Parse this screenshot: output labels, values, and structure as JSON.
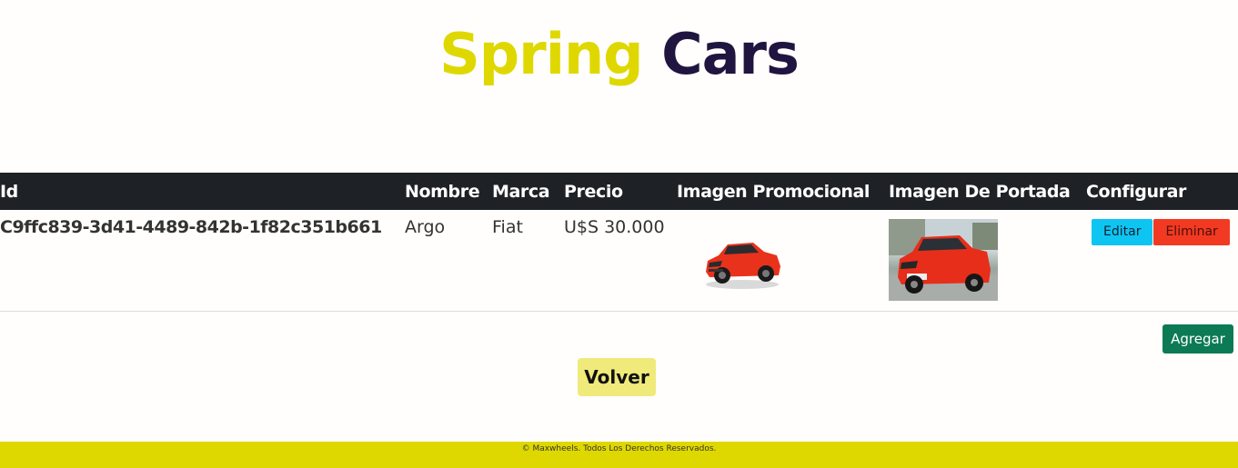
{
  "brand": {
    "word1": "Spring",
    "word2": "Cars"
  },
  "table": {
    "columns": [
      "Id",
      "Nombre",
      "Marca",
      "Precio",
      "Imagen Promocional",
      "Imagen De Portada",
      "Configurar"
    ],
    "rows": [
      {
        "id": "C9ffc839-3d41-4489-842b-1f82c351b661",
        "nombre": "Argo",
        "marca": "Fiat",
        "precio": "U$S 30.000",
        "edit_label": "Editar",
        "delete_label": "Eliminar"
      }
    ]
  },
  "actions": {
    "add_label": "Agregar",
    "back_label": "Volver"
  },
  "footer": {
    "text": "© Maxwheels. Todos Los Derechos Reservados."
  },
  "colors": {
    "brand_yellow": "#dfd800",
    "brand_navy": "#1f1540",
    "header_dark": "#1e2226",
    "edit_cyan": "#0ec5f2",
    "delete_red": "#f23a22",
    "add_green": "#0d7a56",
    "back_yellow": "#f0ea7a"
  }
}
